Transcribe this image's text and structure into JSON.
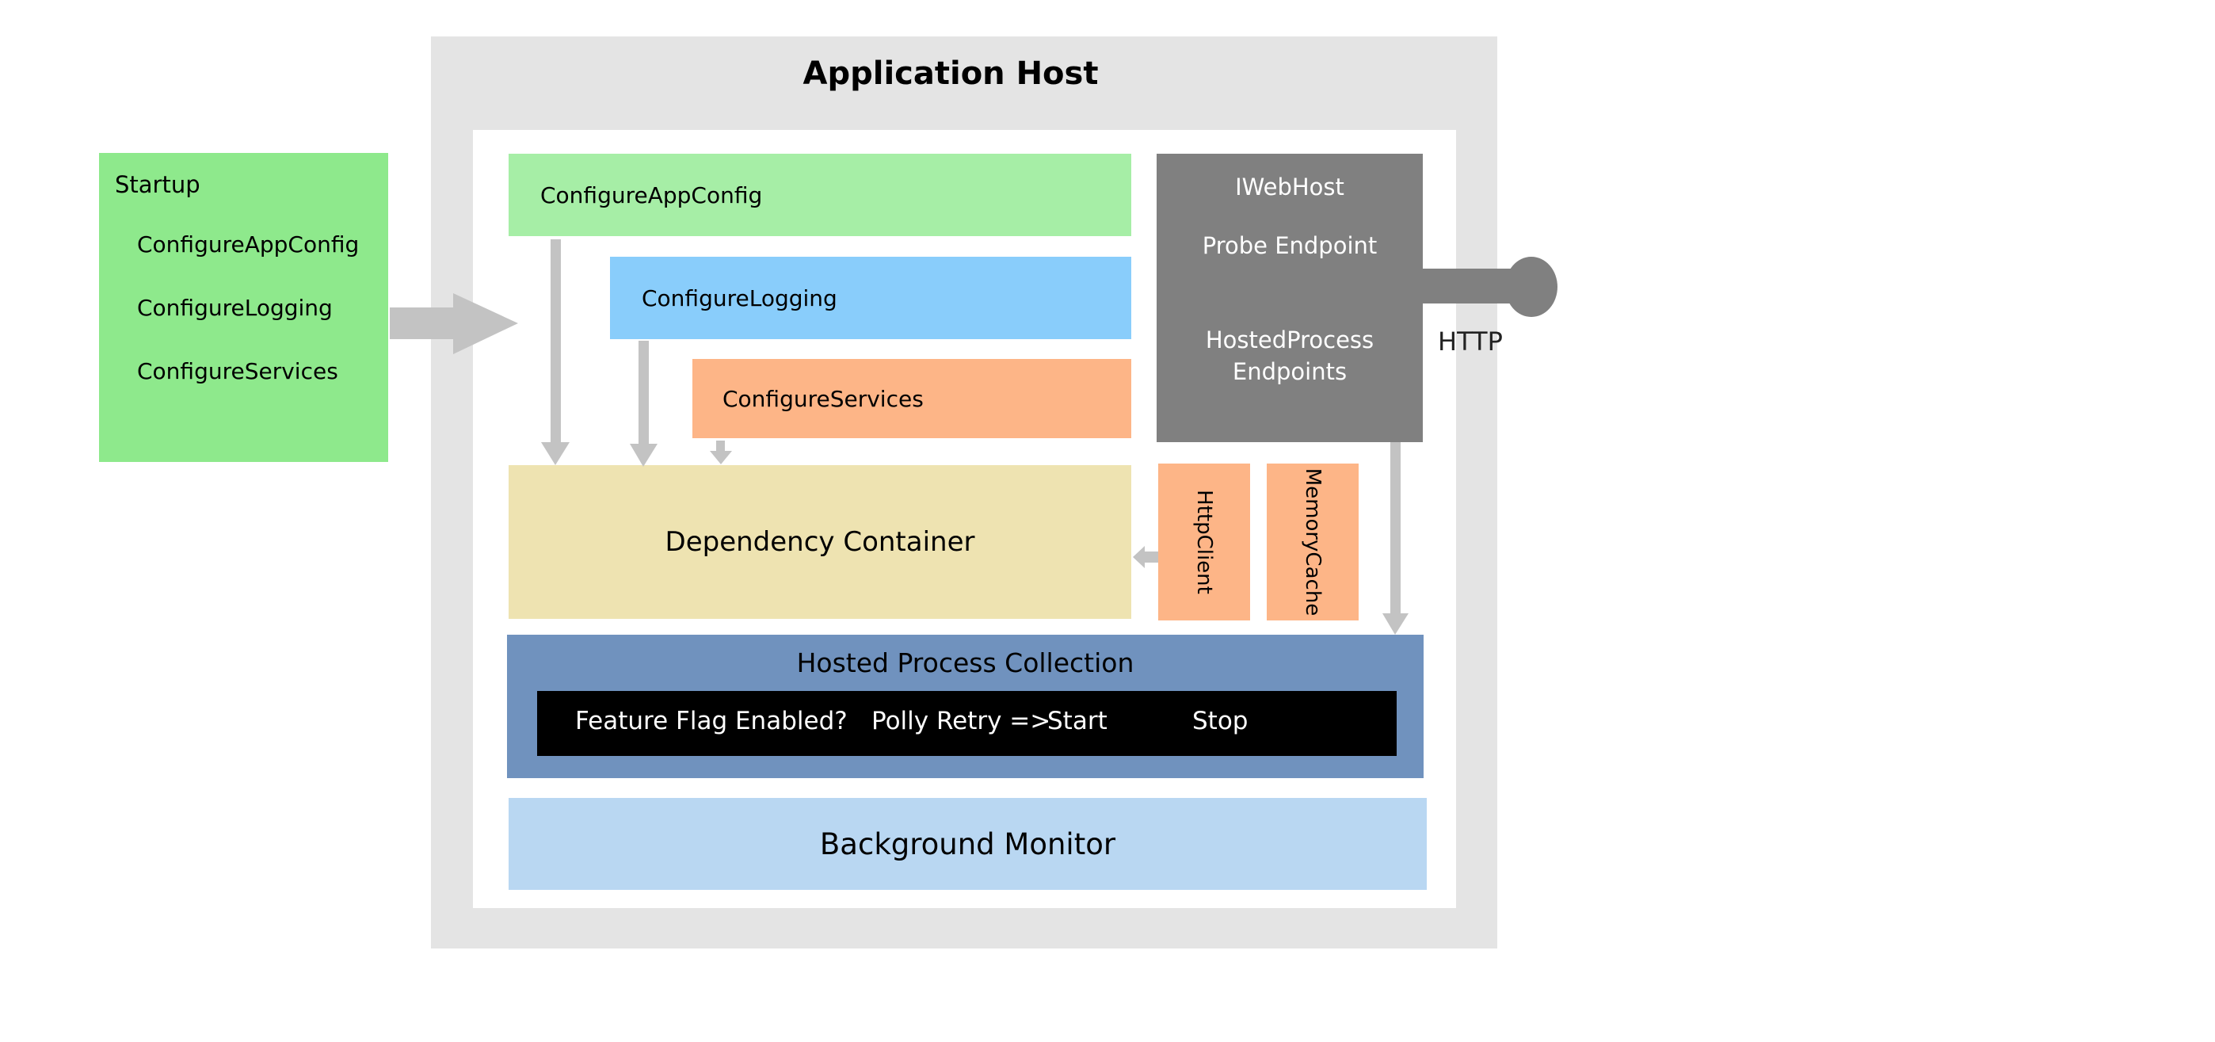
{
  "startup": {
    "title": "Startup",
    "items": [
      "ConfigureAppConfig",
      "ConfigureLogging",
      "ConfigureServices"
    ]
  },
  "host": {
    "title": "Application Host",
    "configure_app_config": "ConfigureAppConfig",
    "configure_logging": "ConfigureLogging",
    "configure_services": "ConfigureServices",
    "dependency_container": "Dependency Container",
    "http_client": "HttpClient",
    "memory_cache": "MemoryCache",
    "iwebhost": {
      "title": "IWebHost",
      "probe": "Probe Endpoint",
      "hosted_line1": "HostedProcess",
      "hosted_line2": "Endpoints"
    },
    "hosted_process_collection": {
      "title": "Hosted Process Collection",
      "steps": [
        "Feature Flag Enabled?",
        "Polly Retry =>",
        "Start",
        "Stop"
      ]
    },
    "background_monitor": "Background Monitor"
  },
  "http_label": "HTTP",
  "colors": {
    "startup": "#8ee98c",
    "app_config": "#a6eea6",
    "logging": "#89cdfb",
    "services": "#fdb587",
    "iwebhost": "#808080",
    "dependency": "#eee3b1",
    "hosted": "#7092be",
    "monitor": "#b9d7f2",
    "arrow": "#c3c3c3"
  }
}
